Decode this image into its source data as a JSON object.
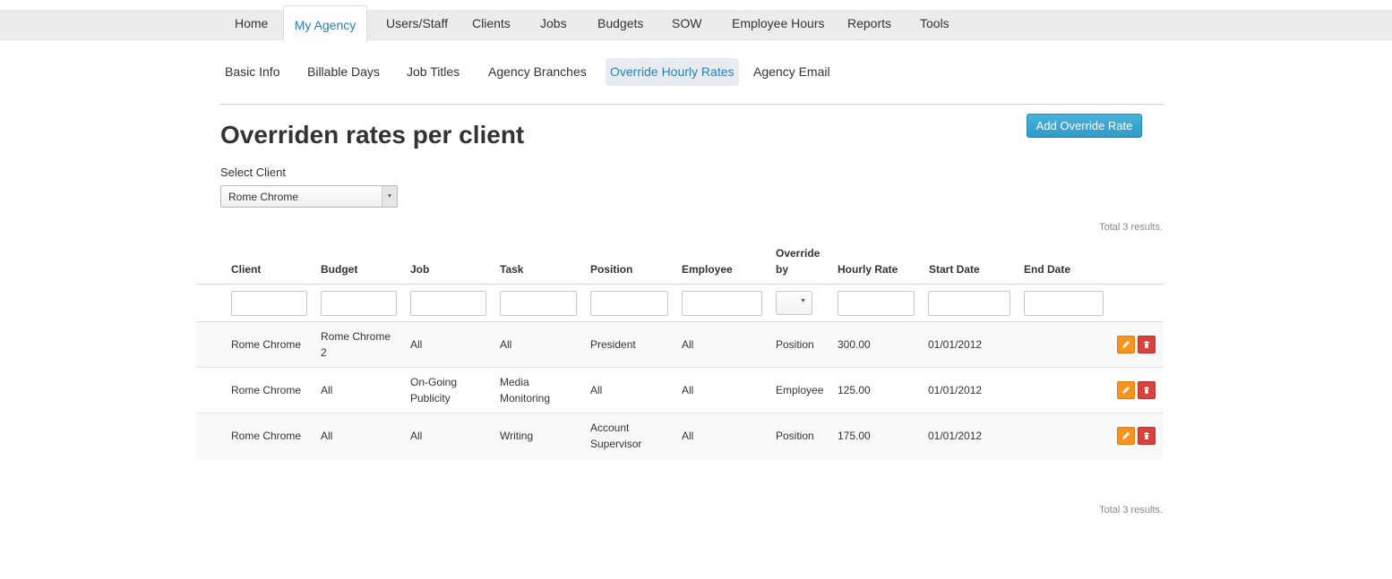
{
  "topnav": {
    "tabs": [
      "Home",
      "My Agency",
      "Users/Staff",
      "Clients",
      "Jobs",
      "Budgets",
      "SOW",
      "Employee Hours",
      "Reports",
      "Tools"
    ],
    "active": "My Agency"
  },
  "subnav": {
    "items": [
      "Basic Info",
      "Billable Days",
      "Job Titles",
      "Agency Branches",
      "Override Hourly Rates",
      "Agency Email"
    ],
    "active": "Override Hourly Rates"
  },
  "page": {
    "title": "Overriden rates per client",
    "add_button": "Add Override Rate",
    "select_label": "Select Client",
    "selected_client": "Rome Chrome",
    "total_top": "Total 3 results.",
    "total_bottom": "Total 3 results."
  },
  "table": {
    "headers": {
      "client": "Client",
      "budget": "Budget",
      "job": "Job",
      "task": "Task",
      "position": "Position",
      "employee": "Employee",
      "override_by_1": "Override",
      "override_by_2": "by",
      "hourly_rate": "Hourly Rate",
      "start_date": "Start Date",
      "end_date": "End Date"
    },
    "rows": [
      {
        "client": "Rome Chrome",
        "budget_1": "Rome Chrome",
        "budget_2": "2",
        "job_1": "All",
        "job_2": "",
        "task_1": "All",
        "task_2": "",
        "position_1": "President",
        "position_2": "",
        "employee": "All",
        "override_by": "Position",
        "hourly_rate": "300.00",
        "start_date": "01/01/2012",
        "end_date": ""
      },
      {
        "client": "Rome Chrome",
        "budget_1": "All",
        "budget_2": "",
        "job_1": "On-Going",
        "job_2": "Publicity",
        "task_1": "Media",
        "task_2": "Monitoring",
        "position_1": "All",
        "position_2": "",
        "employee": "All",
        "override_by": "Employee",
        "hourly_rate": "125.00",
        "start_date": "01/01/2012",
        "end_date": ""
      },
      {
        "client": "Rome Chrome",
        "budget_1": "All",
        "budget_2": "",
        "job_1": "All",
        "job_2": "",
        "task_1": "Writing",
        "task_2": "",
        "position_1": "Account",
        "position_2": "Supervisor",
        "employee": "All",
        "override_by": "Position",
        "hourly_rate": "175.00",
        "start_date": "01/01/2012",
        "end_date": ""
      }
    ]
  },
  "icons": {
    "edit": "pencil-icon",
    "delete": "trash-icon"
  },
  "colors": {
    "link_active": "#2a7fb8",
    "primary_button": "#2f9bc6",
    "edit_button": "#f7941d",
    "delete_button": "#d9413d"
  }
}
